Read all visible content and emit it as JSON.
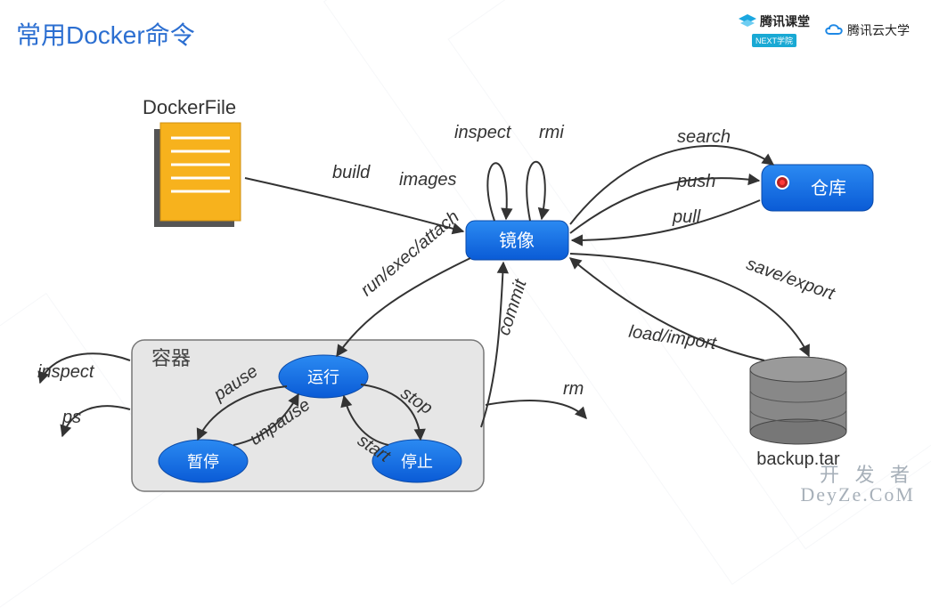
{
  "title": "常用Docker命令",
  "logos": {
    "tencent_class": "腾讯课堂",
    "next_badge": "NEXT学院",
    "tencent_cloud": "腾讯云大学"
  },
  "nodes": {
    "dockerfile": "DockerFile",
    "image": "镜像",
    "registry": "仓库",
    "container_box": "容器",
    "running": "运行",
    "paused": "暂停",
    "stopped": "停止",
    "backup": "backup.tar"
  },
  "edges": {
    "build": "build",
    "images": "images",
    "inspect_img": "inspect",
    "rmi": "rmi",
    "search": "search",
    "push": "push",
    "pull": "pull",
    "save_export": "save/export",
    "load_import": "load/import",
    "run_exec_attach": "run/exec/attach",
    "commit": "commit",
    "rm": "rm",
    "inspect_ctr": "inspect",
    "ps": "ps",
    "pause": "pause",
    "unpause": "unpause",
    "stop": "stop",
    "start": "start"
  },
  "watermark": {
    "line1": "开 发 者",
    "line2": "DeyZe.CoM"
  }
}
